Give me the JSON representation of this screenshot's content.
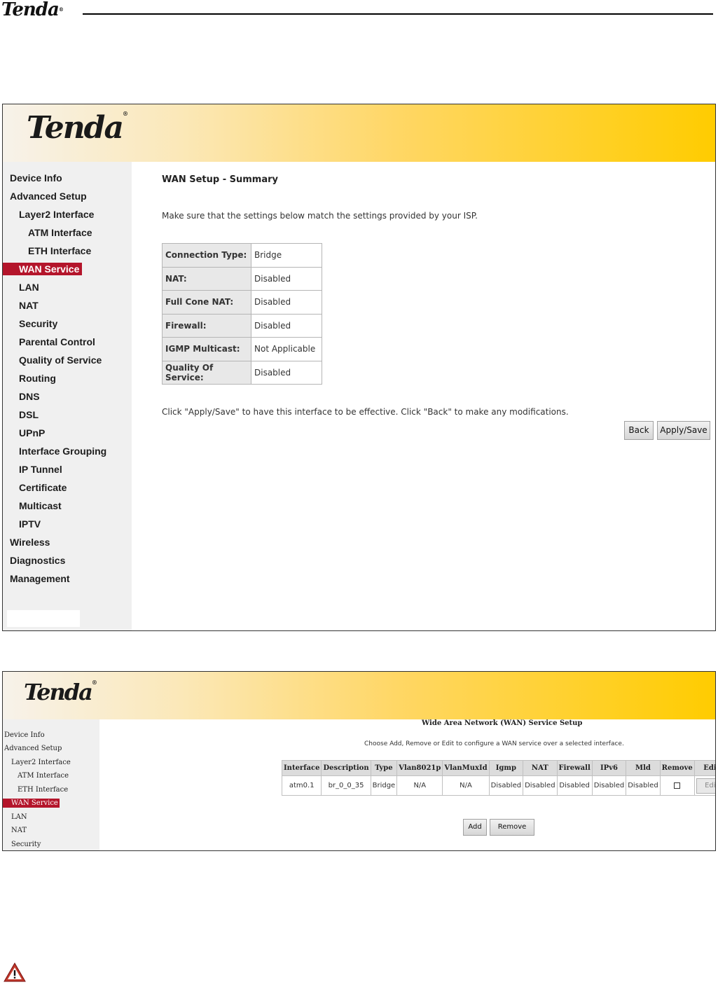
{
  "doc": {
    "logo": "Tenda",
    "reg": "®"
  },
  "panel1": {
    "brand": "Tenda",
    "reg": "®",
    "sidebar": [
      "Device Info",
      "Advanced Setup",
      "Layer2 Interface",
      "ATM Interface",
      "ETH Interface",
      "WAN Service",
      "LAN",
      "NAT",
      "Security",
      "Parental Control",
      "Quality of Service",
      "Routing",
      "DNS",
      "DSL",
      "UPnP",
      "Interface Grouping",
      "IP Tunnel",
      "Certificate",
      "Multicast",
      "IPTV",
      "Wireless",
      "Diagnostics",
      "Management"
    ],
    "active_item": "WAN Service",
    "title": "WAN Setup - Summary",
    "hint": "Make sure that the settings below match the settings provided by your ISP.",
    "rows": [
      {
        "key": "Connection Type:",
        "value": "Bridge"
      },
      {
        "key": "NAT:",
        "value": "Disabled"
      },
      {
        "key": "Full Cone NAT:",
        "value": "Disabled"
      },
      {
        "key": "Firewall:",
        "value": "Disabled"
      },
      {
        "key": "IGMP Multicast:",
        "value": "Not Applicable"
      },
      {
        "key": "Quality Of Service:",
        "value": "Disabled"
      }
    ],
    "footer": "Click \"Apply/Save\" to have this interface to be effective. Click \"Back\" to make any modifications.",
    "back_label": "Back",
    "apply_label": "Apply/Save"
  },
  "panel2": {
    "brand": "Tenda",
    "reg": "®",
    "sidebar": [
      "Device Info",
      "Advanced Setup",
      "Layer2 Interface",
      "ATM Interface",
      "ETH Interface",
      "WAN Service",
      "LAN",
      "NAT",
      "Security"
    ],
    "active_item": "WAN Service",
    "title": "Wide Area Network (WAN) Service Setup",
    "hint": "Choose Add, Remove or Edit to configure a WAN service over a selected interface.",
    "columns": [
      "Interface",
      "Description",
      "Type",
      "Vlan8021p",
      "VlanMuxId",
      "Igmp",
      "NAT",
      "Firewall",
      "IPv6",
      "Mld",
      "Remove",
      "Edit"
    ],
    "row": [
      "atm0.1",
      "br_0_0_35",
      "Bridge",
      "N/A",
      "N/A",
      "Disabled",
      "Disabled",
      "Disabled",
      "Disabled",
      "Disabled",
      "",
      ""
    ],
    "edit_label": "Edit",
    "add_label": "Add",
    "remove_label": "Remove"
  },
  "colors": {
    "active": "#b4152b",
    "banner_end": "#ffcc00",
    "sidebar_bg": "#f0f0f0"
  },
  "icons": {
    "warning": "warning-triangle-icon"
  }
}
